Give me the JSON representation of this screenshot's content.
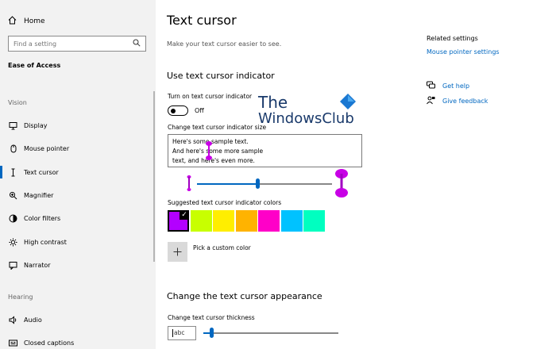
{
  "sidebar": {
    "home_label": "Home",
    "search_placeholder": "Find a setting",
    "section_title": "Ease of Access",
    "group_vision": "Vision",
    "group_hearing": "Hearing",
    "items": [
      {
        "label": "Display",
        "icon": "monitor-icon"
      },
      {
        "label": "Mouse pointer",
        "icon": "mouse-icon"
      },
      {
        "label": "Text cursor",
        "icon": "text-cursor-icon"
      },
      {
        "label": "Magnifier",
        "icon": "magnifier-icon"
      },
      {
        "label": "Color filters",
        "icon": "color-filter-icon"
      },
      {
        "label": "High contrast",
        "icon": "high-contrast-icon"
      },
      {
        "label": "Narrator",
        "icon": "narrator-icon"
      },
      {
        "label": "Audio",
        "icon": "speaker-icon"
      },
      {
        "label": "Closed captions",
        "icon": "captions-icon"
      }
    ],
    "selected": "Text cursor"
  },
  "main": {
    "title": "Text cursor",
    "subtitle": "Make your text cursor easier to see.",
    "indicator_heading": "Use text cursor indicator",
    "toggle_label": "Turn on text cursor indicator",
    "toggle_state": "Off",
    "size_label": "Change text cursor indicator size",
    "sample_lines": [
      "Here's some sample text.",
      "And here's some more sample",
      "text, and here's even more."
    ],
    "size_slider_value": 0.45,
    "colors_label": "Suggested text cursor indicator colors",
    "colors": [
      "#b300ff",
      "#c8ff00",
      "#ffee00",
      "#ffb300",
      "#ff00c8",
      "#00c2ff",
      "#00ffc0"
    ],
    "selected_color_index": 0,
    "pick_custom": "Pick a custom color",
    "appearance_heading": "Change the text cursor appearance",
    "thickness_label": "Change text cursor thickness",
    "thickness_preview": "abc",
    "thickness_slider_value": 0.06
  },
  "related": {
    "title": "Related settings",
    "link": "Mouse pointer settings",
    "help": "Get help",
    "feedback": "Give feedback"
  },
  "watermark": {
    "line1": "The",
    "line2": "WindowsClub"
  },
  "colors": {
    "accent": "#0067c0",
    "indicator": "#c800e6",
    "sidebar_bg": "#f2f2f2"
  }
}
